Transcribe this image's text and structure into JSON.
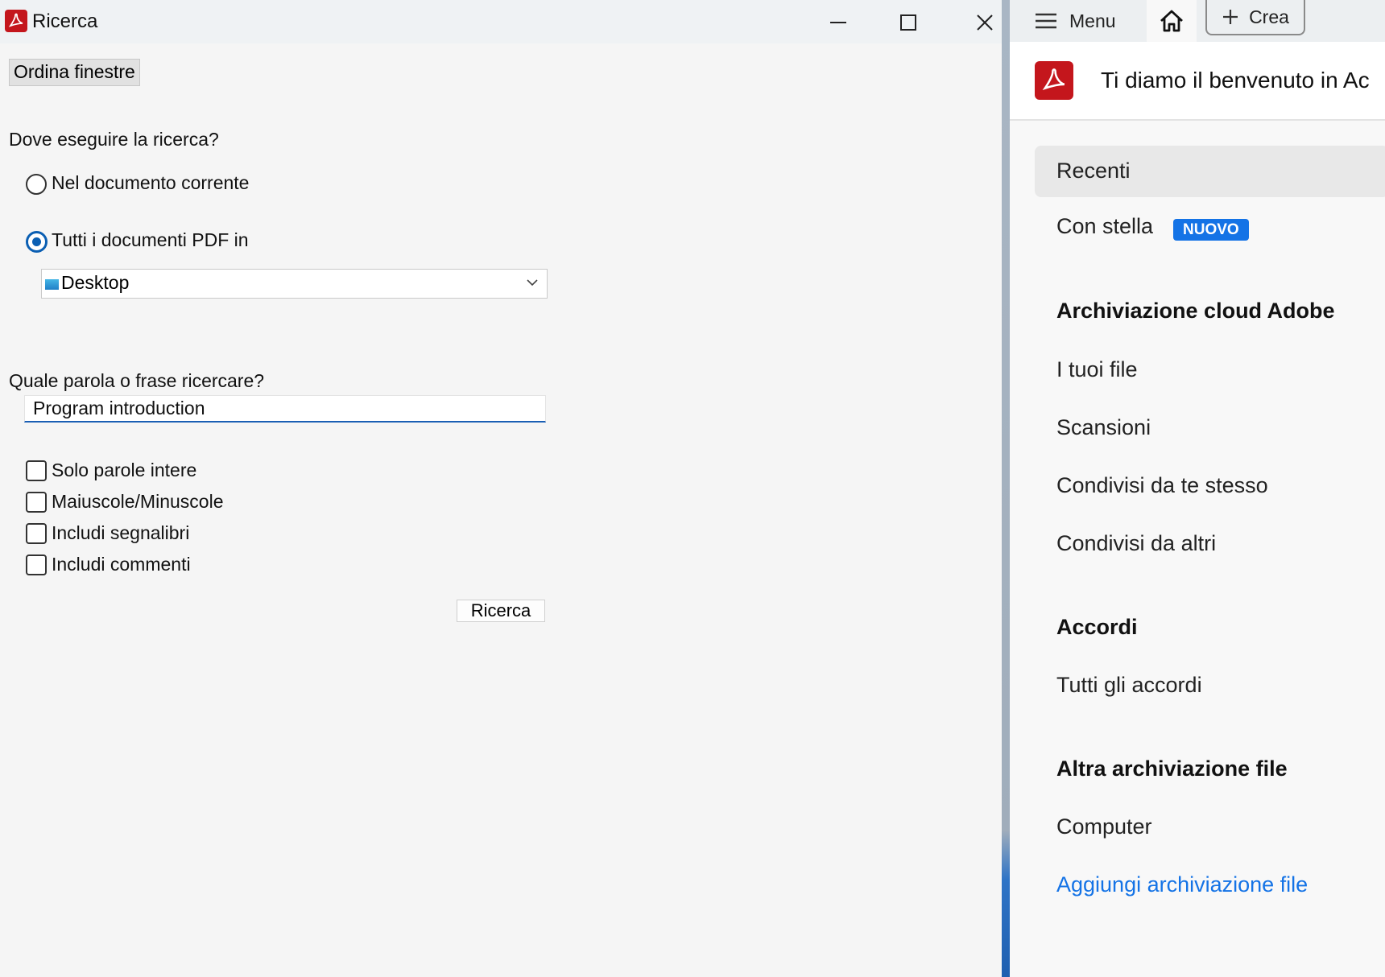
{
  "dialog": {
    "title": "Ricerca",
    "arrange_button": "Ordina finestre",
    "where_label": "Dove eseguire la ricerca?",
    "radio_current": "Nel documento corrente",
    "radio_all": "Tutti i documenti PDF in",
    "location_value": "Desktop",
    "query_label": "Quale parola o frase ricercare?",
    "query_value": "Program introduction",
    "options": [
      "Solo parole intere",
      "Maiuscole/Minuscole",
      "Includi segnalibri",
      "Includi commenti"
    ],
    "search_button": "Ricerca"
  },
  "acrobat": {
    "menu_label": "Menu",
    "create_label": "Crea",
    "welcome": "Ti diamo il benvenuto in Ac",
    "recent": "Recenti",
    "starred": "Con stella",
    "new_badge": "NUOVO",
    "cloud_heading": "Archiviazione cloud Adobe",
    "cloud_items": [
      "I tuoi file",
      "Scansioni",
      "Condivisi da te stesso",
      "Condivisi da altri"
    ],
    "agreements_heading": "Accordi",
    "agreements_items": [
      "Tutti gli accordi"
    ],
    "other_heading": "Altra archiviazione file",
    "computer": "Computer",
    "add_storage": "Aggiungi archiviazione file"
  },
  "colors": {
    "accent": "#1473e6",
    "radio": "#0b5fb3",
    "acrobat_red": "#c4161c"
  }
}
